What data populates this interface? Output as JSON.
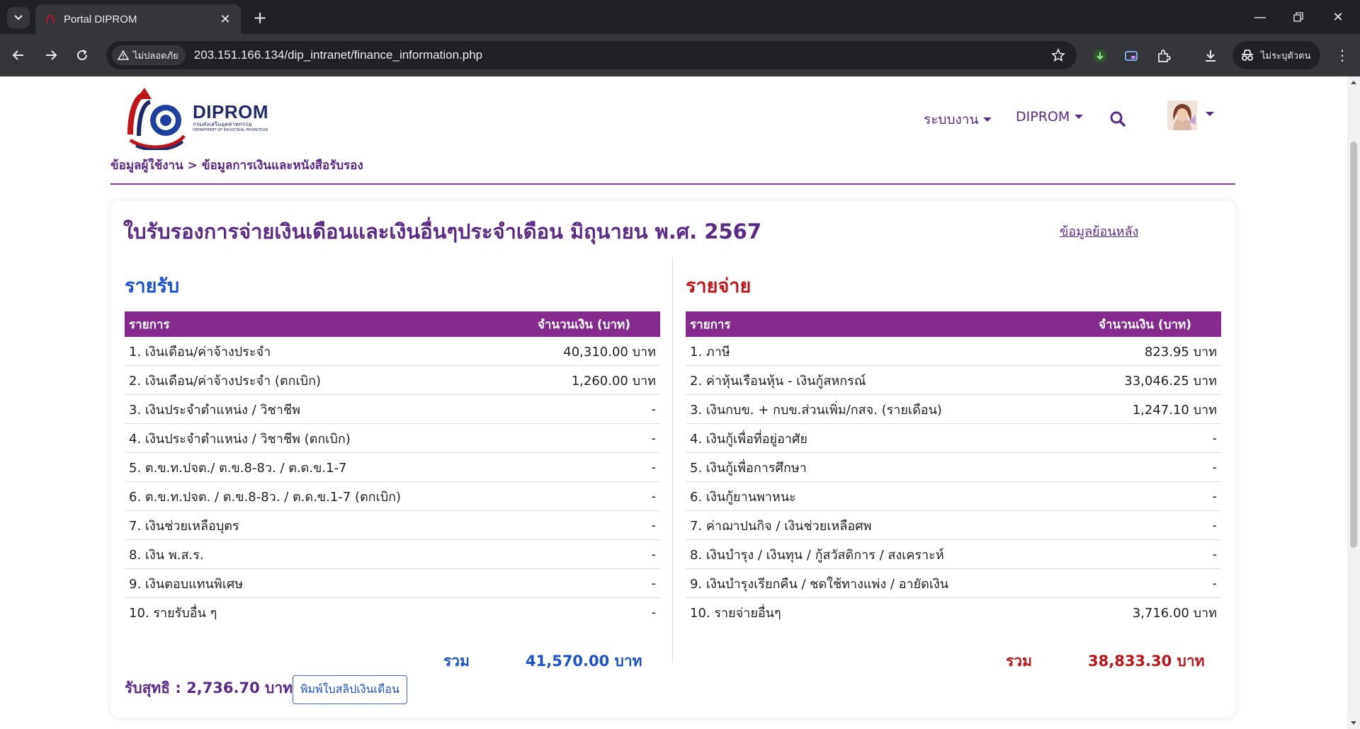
{
  "browser": {
    "tab_title": "Portal DIPROM",
    "security_label": "ไม่ปลอดภัย",
    "url": "203.151.166.134/dip_intranet/finance_information.php",
    "profile_label": "ไม่ระบุตัวตน"
  },
  "site": {
    "logo_name": "DIPROM",
    "logo_sub_th": "กรมส่งเสริมอุตสาหกรรม",
    "logo_sub_en": "DEPARTMENT OF INDUSTRIAL PROMOTION",
    "nav": [
      {
        "label": "ระบบงาน"
      },
      {
        "label": "DIPROM"
      }
    ]
  },
  "breadcrumb": {
    "item1": "ข้อมูลผู้ใช้งาน",
    "separator": ">",
    "item2": "ข้อมูลการเงินและหนังสือรับรอง"
  },
  "card": {
    "title": "ใบรับรองการจ่ายเงินเดือนและเงินอื่นๆประจำเดือน มิถุนายน พ.ศ. 2567",
    "history_link": "ข้อมูลย้อนหลัง"
  },
  "income": {
    "heading": "รายรับ",
    "col_item": "รายการ",
    "col_amount": "จำนวนเงิน (บาท)",
    "rows": [
      {
        "label": "1. เงินเดือน/ค่าจ้างประจำ",
        "amount": "40,310.00 บาท"
      },
      {
        "label": "2. เงินเดือน/ค่าจ้างประจำ (ตกเบิก)",
        "amount": "1,260.00 บาท"
      },
      {
        "label": "3. เงินประจำตำแหน่ง / วิชาชีพ",
        "amount": "-"
      },
      {
        "label": "4. เงินประจำตำแหน่ง / วิชาชีพ (ตกเบิก)",
        "amount": "-"
      },
      {
        "label": "5. ต.ข.ท.ปจต./ ต.ข.8-8ว. / ต.ด.ข.1-7",
        "amount": "-"
      },
      {
        "label": "6. ต.ข.ท.ปจต. / ต.ข.8-8ว. / ต.ด.ข.1-7 (ตกเบิก)",
        "amount": "-"
      },
      {
        "label": "7. เงินช่วยเหลือบุตร",
        "amount": "-"
      },
      {
        "label": "8. เงิน พ.ส.ร.",
        "amount": "-"
      },
      {
        "label": "9. เงินตอบแทนพิเศษ",
        "amount": "-"
      },
      {
        "label": "10. รายรับอื่น ๆ",
        "amount": "-"
      }
    ],
    "total_label": "รวม",
    "total_value": "41,570.00 บาท"
  },
  "expense": {
    "heading": "รายจ่าย",
    "col_item": "รายการ",
    "col_amount": "จำนวนเงิน (บาท)",
    "rows": [
      {
        "label": "1. ภาษี",
        "amount": "823.95 บาท"
      },
      {
        "label": "2. ค่าหุ้นเรือนหุ้น - เงินกู้สหกรณ์",
        "amount": "33,046.25 บาท"
      },
      {
        "label": "3. เงินกบข. + กบข.ส่วนเพิ่ม/กสจ. (รายเดือน)",
        "amount": "1,247.10 บาท"
      },
      {
        "label": "4. เงินกู้เพื่อที่อยู่อาศัย",
        "amount": "-"
      },
      {
        "label": "5. เงินกู้เพื่อการศึกษา",
        "amount": "-"
      },
      {
        "label": "6. เงินกู้ยานพาหนะ",
        "amount": "-"
      },
      {
        "label": "7. ค่าฌาปนกิจ / เงินช่วยเหลือศพ",
        "amount": "-"
      },
      {
        "label": "8. เงินบำรุง / เงินทุน / กู้สวัสดิการ / สงเคราะห์",
        "amount": "-"
      },
      {
        "label": "9. เงินบำรุงเรียกคืน / ชดใช้ทางแพ่ง / อายัดเงิน",
        "amount": "-"
      },
      {
        "label": "10. รายจ่ายอื่นๆ",
        "amount": "3,716.00 บาท"
      }
    ],
    "total_label": "รวม",
    "total_value": "38,833.30 บาท"
  },
  "net": {
    "text": "รับสุทธิ : 2,736.70 บาท",
    "print_button": "พิมพ์ใบสลิปเงินเดือน"
  },
  "colors": {
    "accent_purple": "#862a8f",
    "income_blue": "#1d4fd1",
    "expense_red": "#c0141b"
  },
  "icons": [
    "chevron-down-icon",
    "favicon-icon",
    "close-icon",
    "plus-icon",
    "minimize-icon",
    "restore-icon",
    "close-window-icon",
    "back-icon",
    "forward-icon",
    "reload-icon",
    "warning-icon",
    "star-icon",
    "extension-icon",
    "download-icon",
    "incognito-icon",
    "menu-icon",
    "search-icon"
  ]
}
